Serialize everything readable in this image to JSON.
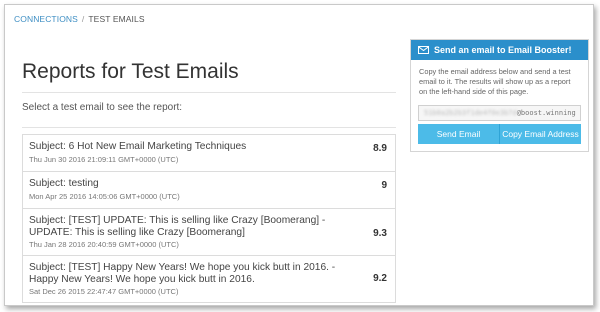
{
  "breadcrumb": {
    "link": "CONNECTIONS",
    "separator": "/",
    "current": "TEST EMAILS"
  },
  "main": {
    "title": "Reports for Test Emails",
    "subtitle": "Select a test email to see the report:"
  },
  "reports": [
    {
      "subject": "Subject: 6 Hot New Email Marketing Techniques",
      "date": "Thu Jun 30 2016 21:09:11 GMT+0000 (UTC)",
      "score": "8.9"
    },
    {
      "subject": "Subject: testing",
      "date": "Mon Apr 25 2016 14:05:06 GMT+0000 (UTC)",
      "score": "9"
    },
    {
      "subject": "Subject: [TEST] UPDATE: This is selling like Crazy [Boomerang] - UPDATE: This is selling like Crazy [Boomerang]",
      "date": "Thu Jan 28 2016 20:40:59 GMT+0000 (UTC)",
      "score": "9.3"
    },
    {
      "subject": "Subject: [TEST] Happy New Years! We hope you kick butt in 2016. - Happy New Years! We hope you kick butt in 2016.",
      "date": "Sat Dec 26 2015 22:47:47 GMT+0000 (UTC)",
      "score": "9.2"
    }
  ],
  "panel": {
    "header_icon": "envelope-icon",
    "header": "Send an email to Email Booster!",
    "instructions": "Copy the email address below and send a test email to it. The results will show up as a report on the left-hand side of this page.",
    "email_redacted": "51b0a2b2b3f1de4f0e3b7d",
    "email_domain": "@boost.winning",
    "send_button": "Send Email",
    "copy_button": "Copy Email Address"
  },
  "colors": {
    "accent": "#2b8fcb",
    "button": "#4cbbe8",
    "link": "#3f8fc4"
  }
}
